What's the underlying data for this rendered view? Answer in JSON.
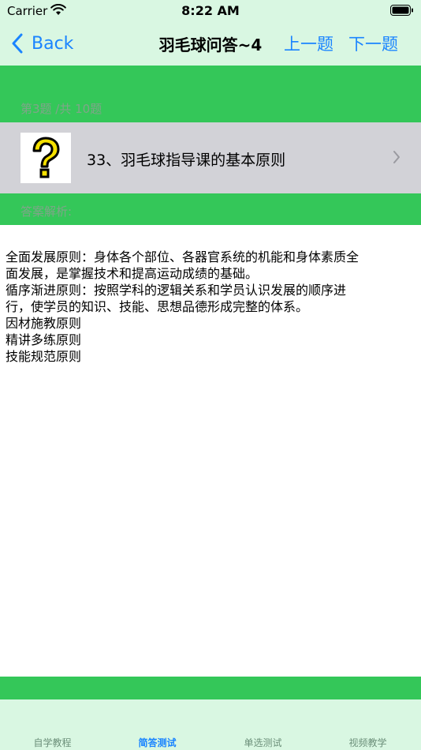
{
  "status_bar": {
    "carrier": "Carrier",
    "time": "8:22 AM"
  },
  "nav": {
    "back_label": "Back",
    "title": "羽毛球问答~4",
    "prev_label": "上一题",
    "next_label": "下一题"
  },
  "progress": {
    "label": "第3题 /共 10题"
  },
  "question": {
    "text": "33、羽毛球指导课的基本原则",
    "icon": "question-mark-icon"
  },
  "answer": {
    "header": "答案解析:",
    "lines": [
      "全面发展原则：身体各个部位、各器官系统的机能和身体素质全",
      "面发展，是掌握技术和提高运动成绩的基础。",
      "循序渐进原则：按照学科的逻辑关系和学员认识发展的顺序进",
      "行，使学员的知识、技能、思想品德形成完整的体系。",
      "因材施教原则",
      "精讲多练原则",
      "技能规范原则"
    ]
  },
  "tabs": [
    {
      "label": "自学教程",
      "active": false
    },
    {
      "label": "简答测试",
      "active": true
    },
    {
      "label": "单选测试",
      "active": false
    },
    {
      "label": "视频教学",
      "active": false
    }
  ],
  "colors": {
    "accent": "#1a84ff",
    "green": "#34c759",
    "light_green": "#d9f7e2",
    "row_gray": "#d2d2d7"
  }
}
